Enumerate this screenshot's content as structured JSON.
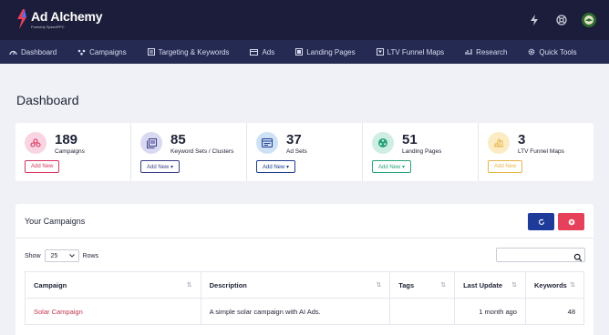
{
  "brand": {
    "title": "Ad Alchemy",
    "subtitle": "Formerly SpeedPPC"
  },
  "topbar_icons": [
    "lightning-icon",
    "help-icon",
    "avatar"
  ],
  "nav": [
    {
      "label": "Dashboard",
      "icon": "gauge-icon"
    },
    {
      "label": "Campaigns",
      "icon": "campaign-icon"
    },
    {
      "label": "Targeting & Keywords",
      "icon": "targeting-icon"
    },
    {
      "label": "Ads",
      "icon": "ads-icon"
    },
    {
      "label": "Landing Pages",
      "icon": "landing-icon"
    },
    {
      "label": "LTV Funnel Maps",
      "icon": "funnel-icon"
    },
    {
      "label": "Research",
      "icon": "chart-icon"
    },
    {
      "label": "Quick Tools",
      "icon": "gear-icon"
    }
  ],
  "page_title": "Dashboard",
  "stats": [
    {
      "count": "189",
      "label": "Campaigns",
      "button": "Add New",
      "color": "#d8345f",
      "bg": "#f9d4e2"
    },
    {
      "count": "85",
      "label": "Keyword Sets / Clusters",
      "button": "Add New ▾",
      "color": "#3b3f8a",
      "bg": "#d9d9f2"
    },
    {
      "count": "37",
      "label": "Ad Sets",
      "button": "Add New ▾",
      "color": "#1d3d8f",
      "bg": "#cfe1f5"
    },
    {
      "count": "51",
      "label": "Landing Pages",
      "button": "Add New ▾",
      "color": "#2aa37c",
      "bg": "#cfeee3"
    },
    {
      "count": "3",
      "label": "LTV Funnel Maps",
      "button": "Add New",
      "color": "#e8b44a",
      "bg": "#fbecc4"
    }
  ],
  "campaigns": {
    "title": "Your Campaigns",
    "show_label": "Show",
    "rows_label": "Rows",
    "page_size": "25",
    "search_placeholder": "",
    "refresh_color": "#1e3b9a",
    "add_color": "#e6405a",
    "columns": [
      "Campaign",
      "Description",
      "Tags",
      "Last Update",
      "Keywords"
    ],
    "rows": [
      {
        "campaign": "Solar Campaign",
        "description": "A simple solar campaign with AI Ads.",
        "tags": "",
        "last_update": "1 month ago",
        "keywords": "48"
      }
    ]
  }
}
